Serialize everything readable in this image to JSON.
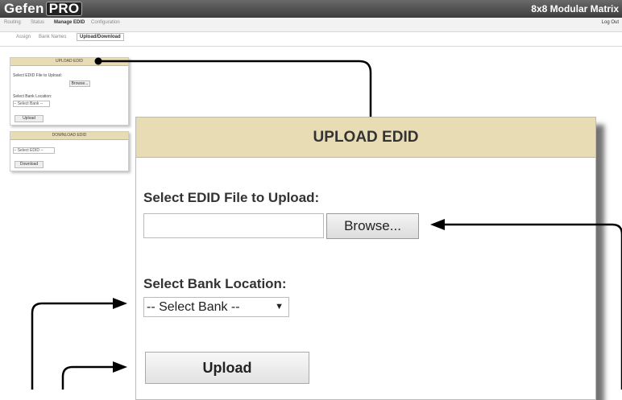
{
  "header": {
    "logo_part1": "Gefen",
    "logo_part2": "PRO",
    "product_name": "8x8 Modular Matrix"
  },
  "nav": {
    "tabs": [
      "Routing",
      "Status",
      "Manage EDID",
      "Configuration"
    ],
    "logout": "Log Out",
    "subtabs": [
      "Assign",
      "Bank Names",
      "Upload/Download"
    ]
  },
  "mini_upload": {
    "title": "UPLOAD EDID",
    "select_file_label": "Select EDID File to Upload:",
    "browse": "Browse...",
    "bank_label": "Select Bank Location:",
    "bank_value": "-- Select Bank --",
    "upload": "Upload"
  },
  "mini_download": {
    "title": "DOWNLOAD EDID",
    "select_value": "-- Select EDID --",
    "download": "Download"
  },
  "upload_panel": {
    "title": "UPLOAD EDID",
    "file_label": "Select EDID File to Upload:",
    "file_value": "",
    "browse_label": "Browse...",
    "bank_label": "Select Bank Location:",
    "bank_value": "-- Select Bank --",
    "upload_label": "Upload"
  },
  "colors": {
    "header_bar": "#4a4a4a",
    "panel_header": "#e8dcb4",
    "callout_line": "#000000"
  }
}
